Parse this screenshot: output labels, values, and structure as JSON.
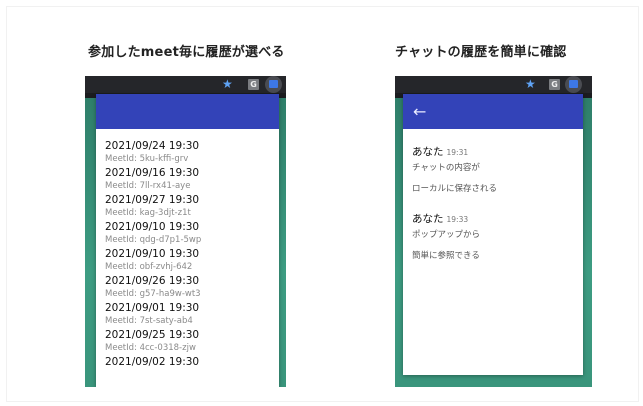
{
  "captions": {
    "left": "参加したmeet毎に履歴が選べる",
    "right": "チャットの履歴を簡単に確認"
  },
  "toolbar": {
    "star_icon": "★",
    "g_icon": "G"
  },
  "meet_list": [
    {
      "date": "2021/09/24 19:30",
      "meet_id": "MeetId: 5ku-kffi-grv"
    },
    {
      "date": "2021/09/16 19:30",
      "meet_id": "MeetId: 7ll-rx41-aye"
    },
    {
      "date": "2021/09/27 19:30",
      "meet_id": "MeetId: kag-3djt-z1t"
    },
    {
      "date": "2021/09/10 19:30",
      "meet_id": "MeetId: qdg-d7p1-5wp"
    },
    {
      "date": "2021/09/10 19:30",
      "meet_id": "MeetId: obf-zvhj-642"
    },
    {
      "date": "2021/09/26 19:30",
      "meet_id": "MeetId: g57-ha9w-wt3"
    },
    {
      "date": "2021/09/01 19:30",
      "meet_id": "MeetId: 7st-saty-ab4"
    },
    {
      "date": "2021/09/25 19:30",
      "meet_id": "MeetId: 4cc-0318-zjw"
    },
    {
      "date": "2021/09/02 19:30",
      "meet_id": ""
    }
  ],
  "chat": {
    "back_icon": "←",
    "messages": [
      {
        "author": "あなた",
        "time": "19:31",
        "lines": [
          "チャットの内容が",
          "ローカルに保存される"
        ]
      },
      {
        "author": "あなた",
        "time": "19:33",
        "lines": [
          "ポップアップから",
          "簡単に参照できる"
        ]
      }
    ]
  },
  "colors": {
    "header": "#3343b8",
    "teal_background": "#3d9c82",
    "browser_bar": "#25262a"
  }
}
